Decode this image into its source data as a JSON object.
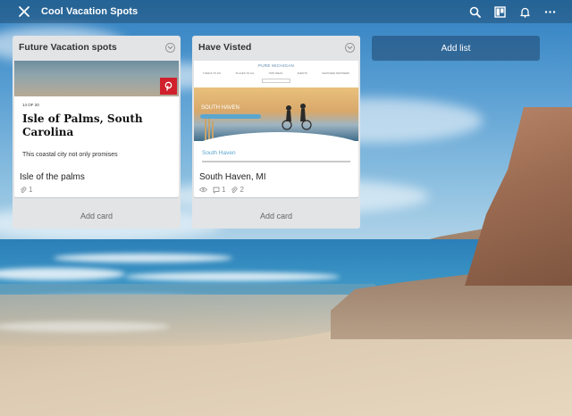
{
  "topbar": {
    "board_title": "Cool Vacation Spots",
    "icons": [
      "close-icon",
      "search-icon",
      "board-view-icon",
      "notifications-bell-icon",
      "more-options-icon"
    ]
  },
  "lists": [
    {
      "title": "Future Vacation spots",
      "card": {
        "title": "Isle of the palms",
        "attachments": "1",
        "cover": {
          "kicker": "14 OF 20",
          "headline": "Isle of Palms, South Carolina",
          "text": "This coastal city not only promises"
        }
      },
      "add_card_label": "Add card"
    },
    {
      "title": "Have Visted",
      "card": {
        "title": "South Haven, MI",
        "comments": "1",
        "attachments": "2",
        "cover": {
          "logo": "PURE MICHIGAN",
          "nav": [
            "THINGS TO DO",
            "PLACES TO GO",
            "TRIP IDEAS",
            "EVENTS",
            "FEATURED PARTNERS"
          ],
          "hero_title": "SOUTH HAVEN",
          "subhead": "South Haven"
        }
      },
      "add_card_label": "Add card"
    }
  ],
  "add_list_label": "Add list",
  "colors": {
    "list_bg": "#e2e4e6",
    "pinterest_red": "#d0202c",
    "link_blue": "#5aa6cf"
  }
}
